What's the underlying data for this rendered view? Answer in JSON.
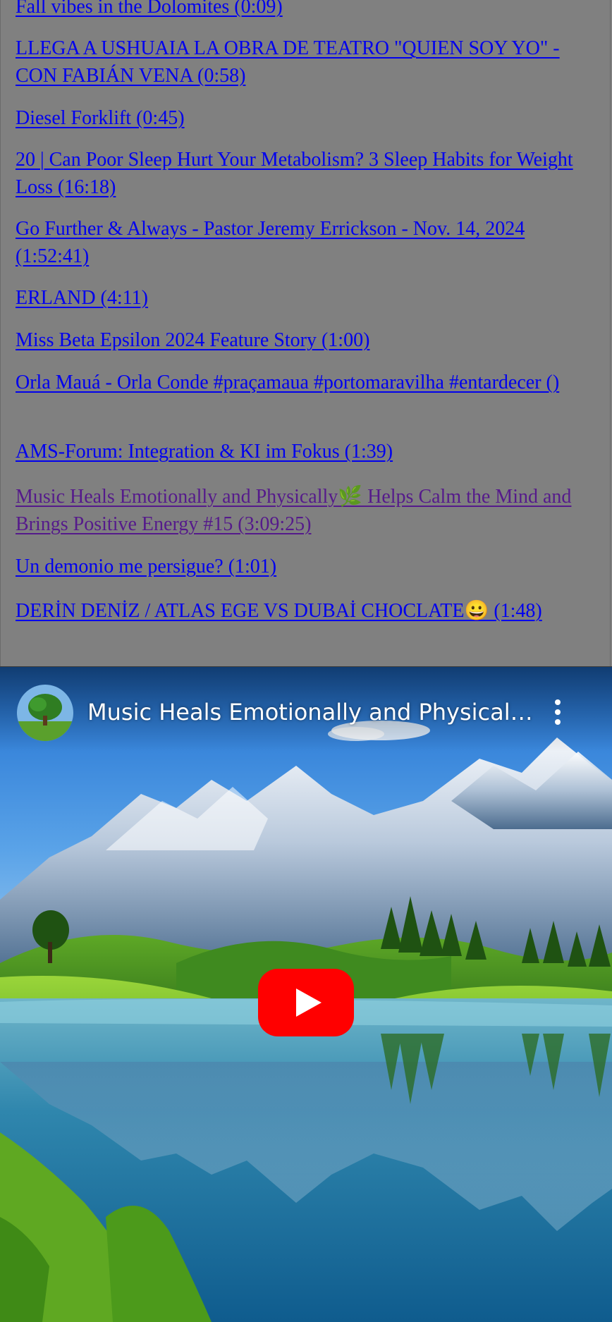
{
  "video_list": [
    {
      "title": "Fall vibes in the Dolomites (0:09)",
      "visited": false
    },
    {
      "title": "LLEGA A USHUAIA LA OBRA DE TEATRO \"QUIEN SOY YO\" - CON FABIÁN VENA (0:58)",
      "visited": false
    },
    {
      "title": "Diesel Forklift (0:45)",
      "visited": false
    },
    {
      "title": "20 | Can Poor Sleep Hurt Your Metabolism? 3 Sleep Habits for Weight Loss (16:18)",
      "visited": false
    },
    {
      "title": "Go Further & Always - Pastor Jeremy Errickson - Nov. 14, 2024 (1:52:41)",
      "visited": false
    },
    {
      "title": "ERLAND (4:11)",
      "visited": false
    },
    {
      "title": "Miss Beta Epsilon 2024 Feature Story (1:00)",
      "visited": false
    },
    {
      "title": "Orla Mauá - Orla Conde #praçamaua #portomaravilha #entardecer ()",
      "visited": false
    },
    {
      "title": "AMS-Forum: Integration & KI im Fokus (1:39)",
      "visited": false
    },
    {
      "title": "Music Heals Emotionally and Physically🌿 Helps Calm the Mind and Brings Positive Energy #15 (3:09:25)",
      "visited": true
    },
    {
      "title": "Un demonio me persigue? (1:01)",
      "visited": false
    },
    {
      "title": "DERİN DENİZ / ATLAS EGE VS DUBAİ CHOCLATE😀 (1:48)",
      "visited": false
    }
  ],
  "player": {
    "title": "Music Heals Emotionally and Physically🌿 Helps Calm the Mind and Brings Positive Energy #15",
    "avatar_icon": "tree-avatar-icon",
    "menu_icon": "more-vertical-icon",
    "play_icon": "youtube-play-icon",
    "play_color": "#ff0000"
  },
  "colors": {
    "page_background": "#808080",
    "link": "#0000ee",
    "visited_link": "#551a8b"
  }
}
